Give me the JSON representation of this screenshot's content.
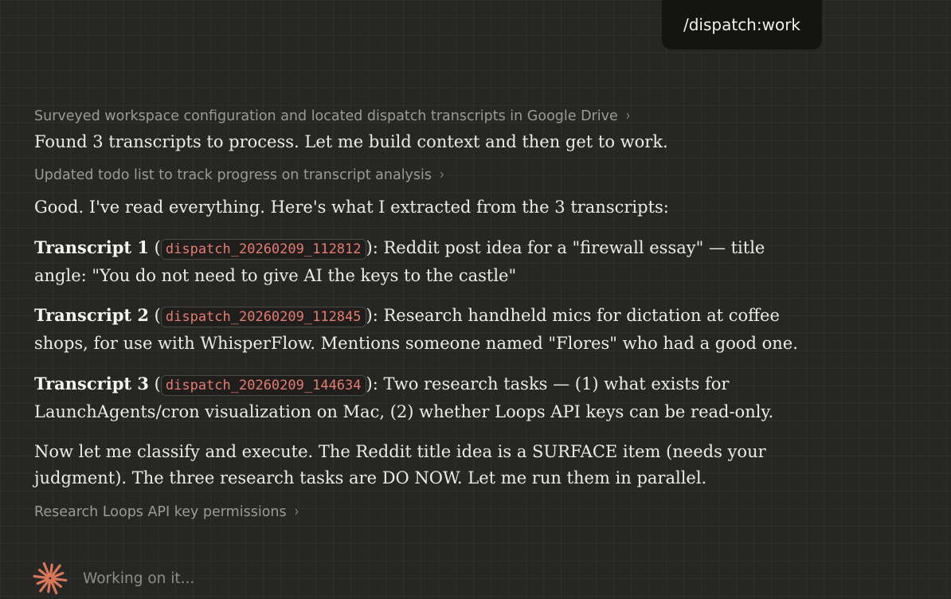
{
  "user_message": "/dispatch:work",
  "steps": {
    "survey": "Surveyed workspace configuration and located dispatch transcripts in Google Drive",
    "found": "Found 3 transcripts to process. Let me build context and then get to work.",
    "todo": "Updated todo list to track progress on transcript analysis",
    "good": "Good. I've read everything. Here's what I extracted from the 3 transcripts:",
    "research": "Research Loops API key permissions"
  },
  "transcripts": [
    {
      "label": "Transcript 1",
      "open": " (",
      "id": "dispatch_20260209_112812",
      "close": "): ",
      "text": "Reddit post idea for a \"firewall essay\" — title angle: \"You do not need to give AI the keys to the castle\""
    },
    {
      "label": "Transcript 2",
      "open": " (",
      "id": "dispatch_20260209_112845",
      "close": "): ",
      "text": "Research handheld mics for dictation at coffee shops, for use with WhisperFlow. Mentions someone named \"Flores\" who had a good one."
    },
    {
      "label": "Transcript 3",
      "open": " (",
      "id": "dispatch_20260209_144634",
      "close": "): ",
      "text": "Two research tasks — (1) what exists for LaunchAgents/cron visualization on Mac, (2) whether Loops API keys can be read-only."
    }
  ],
  "classify": "Now let me classify and execute. The Reddit title idea is a SURFACE item (needs your judgment). The three research tasks are DO NOW. Let me run them in parallel.",
  "chevron_glyph": "›",
  "status": {
    "text": "Working on it...",
    "icon": "sparkle-icon",
    "icon_color": "#d9775a"
  },
  "colors": {
    "background": "#262624",
    "code_text": "#e57c72",
    "bubble": "#141413"
  }
}
